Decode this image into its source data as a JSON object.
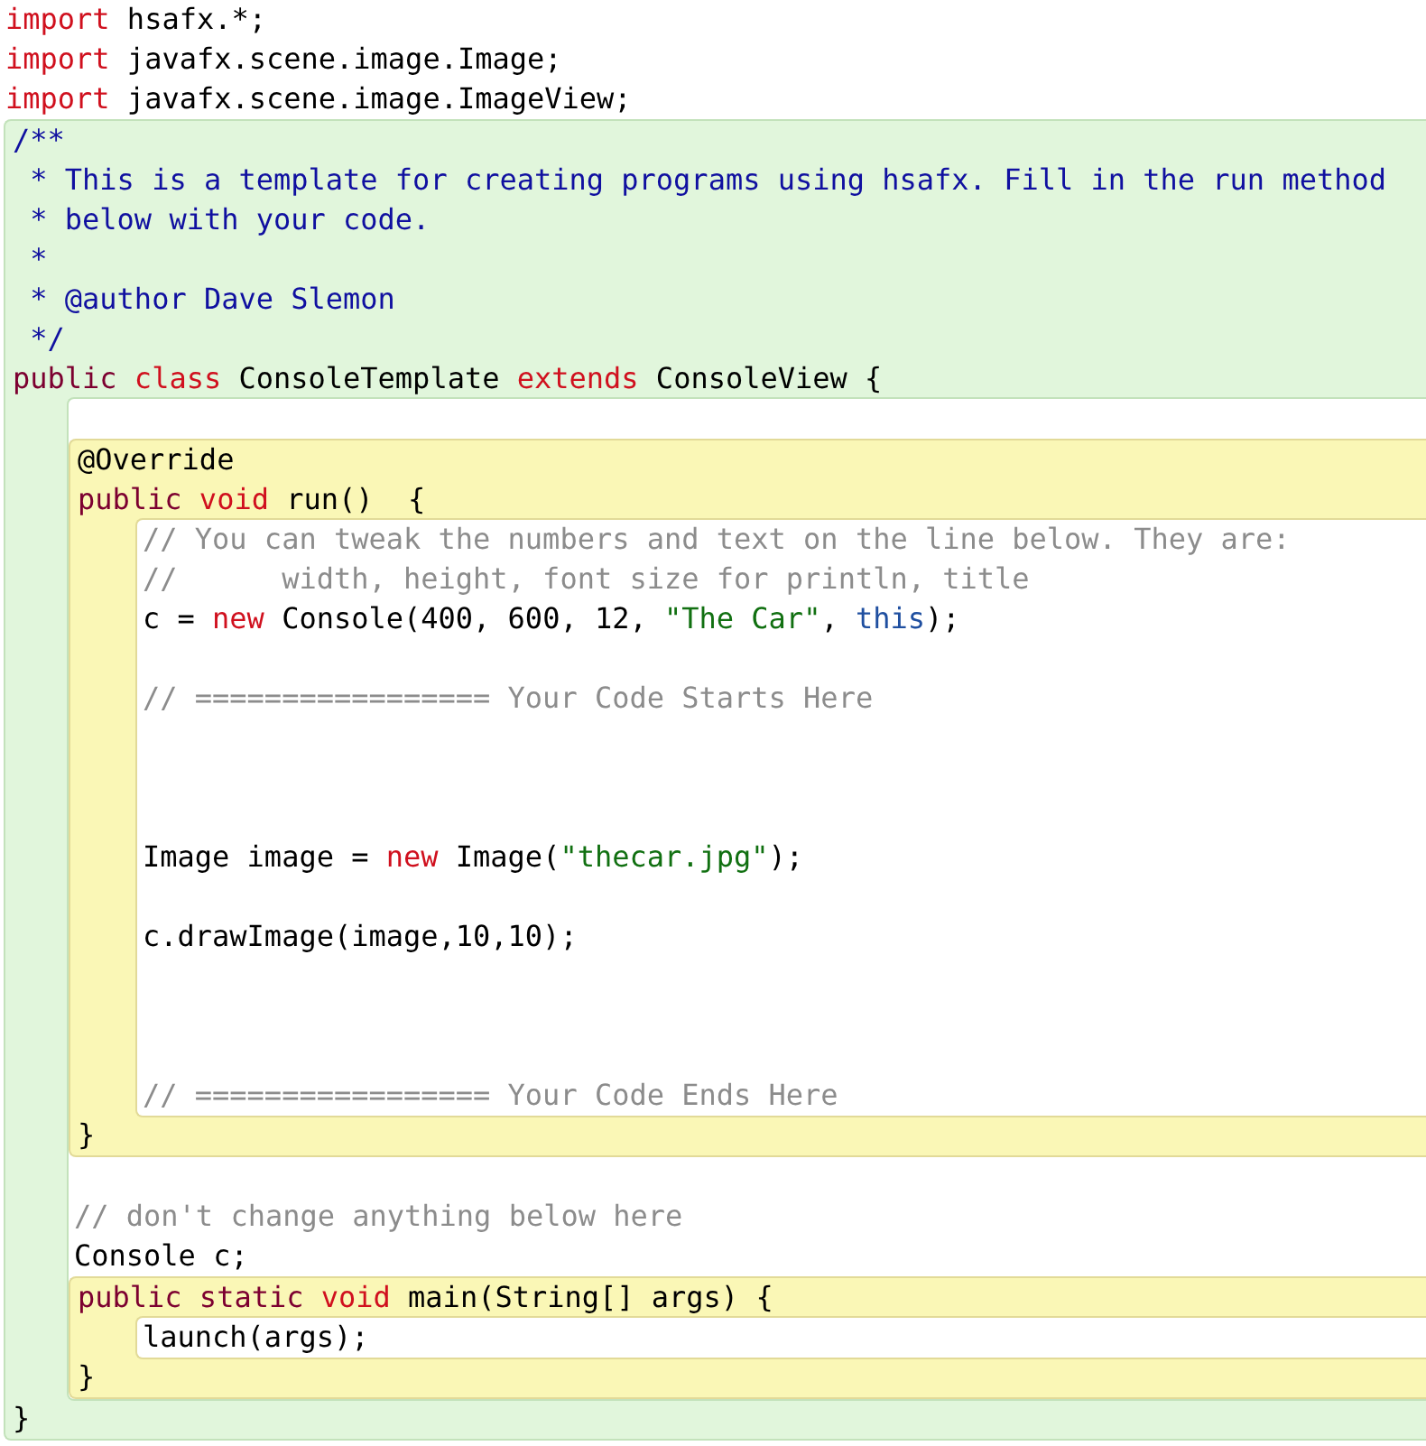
{
  "code": [
    {
      "kind": "line",
      "tokens": [
        {
          "text": "import",
          "kind": "keyword"
        },
        {
          "text": " hsafx.*;",
          "kind": "plain"
        }
      ]
    },
    {
      "kind": "line",
      "tokens": [
        {
          "text": "import",
          "kind": "keyword"
        },
        {
          "text": " javafx.scene.image.Image;",
          "kind": "plain"
        }
      ]
    },
    {
      "kind": "line",
      "tokens": [
        {
          "text": "import",
          "kind": "keyword"
        },
        {
          "text": " javafx.scene.image.ImageView;",
          "kind": "plain"
        }
      ]
    },
    {
      "kind": "class_scope",
      "header": [
        {
          "kind": "line",
          "tokens": [
            {
              "text": "/**",
              "kind": "javadoc"
            }
          ]
        },
        {
          "kind": "line",
          "tokens": [
            {
              "text": " * This is a template for creating programs using hsafx. Fill in the run method",
              "kind": "javadoc"
            }
          ]
        },
        {
          "kind": "line",
          "tokens": [
            {
              "text": " * below with your code.",
              "kind": "javadoc"
            }
          ]
        },
        {
          "kind": "line",
          "tokens": [
            {
              "text": " *",
              "kind": "javadoc"
            }
          ]
        },
        {
          "kind": "line",
          "tokens": [
            {
              "text": " * @author Dave Slemon",
              "kind": "javadoc"
            }
          ]
        },
        {
          "kind": "line",
          "tokens": [
            {
              "text": " */",
              "kind": "javadoc"
            }
          ]
        },
        {
          "kind": "line",
          "tokens": [
            {
              "text": "public",
              "kind": "modifier"
            },
            {
              "text": " class",
              "kind": "keyword"
            },
            {
              "text": " ConsoleTemplate ",
              "kind": "plain"
            },
            {
              "text": "extends",
              "kind": "keyword"
            },
            {
              "text": " ConsoleView {",
              "kind": "plain"
            }
          ]
        }
      ],
      "body": [
        {
          "kind": "blank"
        },
        {
          "kind": "method_scope",
          "header": [
            {
              "kind": "line",
              "tokens": [
                {
                  "text": "@Override",
                  "kind": "plain"
                }
              ]
            },
            {
              "kind": "line",
              "tokens": [
                {
                  "text": "public",
                  "kind": "modifier"
                },
                {
                  "text": " void",
                  "kind": "keyword"
                },
                {
                  "text": " run()  {",
                  "kind": "plain"
                }
              ]
            }
          ],
          "body": [
            {
              "kind": "line",
              "tokens": [
                {
                  "text": "// You can tweak the numbers and text on the line below. They are:",
                  "kind": "comment"
                }
              ]
            },
            {
              "kind": "line",
              "tokens": [
                {
                  "text": "//      width, height, font size for println, title",
                  "kind": "comment"
                }
              ]
            },
            {
              "kind": "line",
              "tokens": [
                {
                  "text": "c = ",
                  "kind": "plain"
                },
                {
                  "text": "new",
                  "kind": "keyword"
                },
                {
                  "text": " Console(400, 600, 12, ",
                  "kind": "plain"
                },
                {
                  "text": "\"The Car\"",
                  "kind": "string"
                },
                {
                  "text": ", ",
                  "kind": "plain"
                },
                {
                  "text": "this",
                  "kind": "this"
                },
                {
                  "text": ");",
                  "kind": "plain"
                }
              ]
            },
            {
              "kind": "blank"
            },
            {
              "kind": "line",
              "tokens": [
                {
                  "text": "// ================= Your Code Starts Here",
                  "kind": "comment"
                }
              ]
            },
            {
              "kind": "blank"
            },
            {
              "kind": "blank"
            },
            {
              "kind": "blank"
            },
            {
              "kind": "line",
              "tokens": [
                {
                  "text": "Image image = ",
                  "kind": "plain"
                },
                {
                  "text": "new",
                  "kind": "keyword"
                },
                {
                  "text": " Image(",
                  "kind": "plain"
                },
                {
                  "text": "\"thecar.jpg\"",
                  "kind": "string"
                },
                {
                  "text": ");",
                  "kind": "plain"
                }
              ]
            },
            {
              "kind": "blank"
            },
            {
              "kind": "line",
              "tokens": [
                {
                  "text": "c.drawImage(image,10,10);",
                  "kind": "plain"
                }
              ]
            },
            {
              "kind": "blank"
            },
            {
              "kind": "blank"
            },
            {
              "kind": "blank"
            },
            {
              "kind": "line",
              "tokens": [
                {
                  "text": "// ================= Your Code Ends Here",
                  "kind": "comment"
                }
              ]
            }
          ],
          "footer": [
            {
              "kind": "line",
              "tokens": [
                {
                  "text": "}",
                  "kind": "plain"
                }
              ]
            }
          ]
        },
        {
          "kind": "blank"
        },
        {
          "kind": "line",
          "tokens": [
            {
              "text": "// don't change anything below here",
              "kind": "comment"
            }
          ]
        },
        {
          "kind": "line",
          "tokens": [
            {
              "text": "Console c;",
              "kind": "plain"
            }
          ]
        },
        {
          "kind": "method_scope",
          "header": [
            {
              "kind": "line",
              "tokens": [
                {
                  "text": "public",
                  "kind": "modifier"
                },
                {
                  "text": " static",
                  "kind": "modifier"
                },
                {
                  "text": " void",
                  "kind": "keyword"
                },
                {
                  "text": " main(String[] args) {",
                  "kind": "plain"
                }
              ]
            }
          ],
          "body": [
            {
              "kind": "line",
              "tokens": [
                {
                  "text": "launch(args);",
                  "kind": "plain"
                }
              ]
            }
          ],
          "footer": [
            {
              "kind": "line",
              "tokens": [
                {
                  "text": "}",
                  "kind": "plain"
                }
              ]
            }
          ]
        }
      ],
      "footer": [
        {
          "kind": "line",
          "tokens": [
            {
              "text": "}",
              "kind": "plain"
            }
          ]
        }
      ]
    }
  ]
}
